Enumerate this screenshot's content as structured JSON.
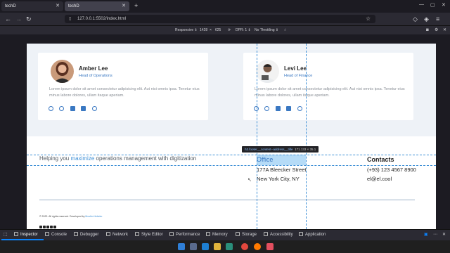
{
  "tabs": [
    {
      "label": "techD"
    },
    {
      "label": "techD"
    }
  ],
  "url": "127.0.0.1:5502/index.html",
  "rdm": {
    "mode": "Responsive ⇕",
    "width": "1428",
    "height": "625",
    "dpr": "DPR: 1 ⇕",
    "throttle": "No Throttling ⇕"
  },
  "team": [
    {
      "name": "Amber Lee",
      "role": "Head of Operations",
      "desc": "Lorem ipsum dolor sit amet consectetur adipisicing elit. Aut nisi omnis ipsa. Tenetur eius minus labore dolores, ullam itaque aperiam."
    },
    {
      "name": "Levi Lee",
      "role": "Head of Finance",
      "desc": "Lorem ipsum dolor sit amet consectetur adipisicing elit. Aut nisi omnis ipsa. Tenetur eius minus labore dolores, ullam itaque aperiam."
    }
  ],
  "footer": {
    "tagline_pre": "Helping you ",
    "tagline_hl": "maximize",
    "tagline_post": " operations management with digitization",
    "office_title": "Office",
    "office_line1": "177A Bleecker Street",
    "office_line2": "New York City, NY",
    "contacts_title": "Contacts",
    "contacts_phone": "(+93) 123 4567 8900",
    "contacts_email": "el@el.cool",
    "copyright": "© 2022. All rights reserved. Developed by ",
    "developer": "Muslim Hekeko"
  },
  "inspector_tooltip": {
    "selector": "h3.footer__content--address__title",
    "size": "171.133 × 35.1"
  },
  "devtools": {
    "tabs": [
      "Inspector",
      "Console",
      "Debugger",
      "Network",
      "Style Editor",
      "Performance",
      "Memory",
      "Storage",
      "Accessibility",
      "Application"
    ]
  },
  "colors": {
    "accent": "#3a78c2",
    "highlight": "#3d8fd6",
    "page_bg": "#eef2f7",
    "chrome_dark": "#1c1b22"
  }
}
